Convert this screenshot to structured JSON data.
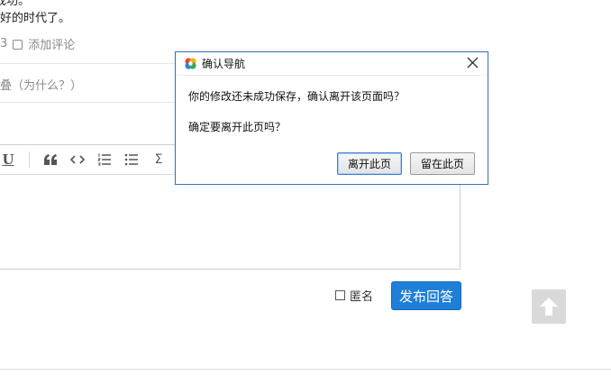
{
  "background": {
    "text_fragment_top": "成功。",
    "text_fragment_line": "好的时代了。",
    "meta_count_fragment": "3",
    "add_comment": "添加评论",
    "fold_hint": "叠（为什么？）",
    "anonymous_label": "匿名",
    "publish_button": "发布回答"
  },
  "toolbar": {
    "icons": [
      "underline-icon",
      "quote-icon",
      "code-icon",
      "ordered-list-icon",
      "unordered-list-icon",
      "formula-icon"
    ],
    "underline_glyph": "U",
    "quote_glyph": "66",
    "code_glyph": "<>",
    "sigma_glyph": "Σ"
  },
  "dialog": {
    "title": "确认导航",
    "message_primary": "你的修改还未成功保存，确认离开该页面吗？",
    "message_secondary": "确定要离开此页吗？",
    "leave_button": "离开此页",
    "stay_button": "留在此页"
  },
  "colors": {
    "publish_button_bg": "#1f7fd8",
    "dialog_border": "#3a72b8",
    "scroll_top_bg": "#d9d9d9"
  }
}
